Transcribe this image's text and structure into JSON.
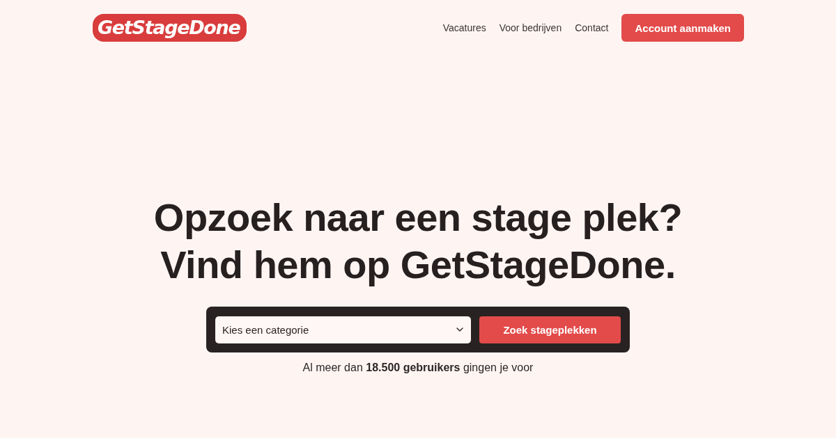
{
  "header": {
    "logo": "GetStageDone",
    "nav": [
      {
        "label": "Vacatures"
      },
      {
        "label": "Voor bedrijven"
      },
      {
        "label": "Contact"
      }
    ],
    "cta": "Account aanmaken"
  },
  "hero": {
    "headline": [
      "Opzoek naar een stage plek?",
      "Vind hem op GetStageDone."
    ],
    "search": {
      "category_select": {
        "placeholder": "Kies een categorie"
      },
      "button": "Zoek stageplekken"
    },
    "note": "Al meer dan **18.500 gebruikers** gingen je voor"
  }
}
